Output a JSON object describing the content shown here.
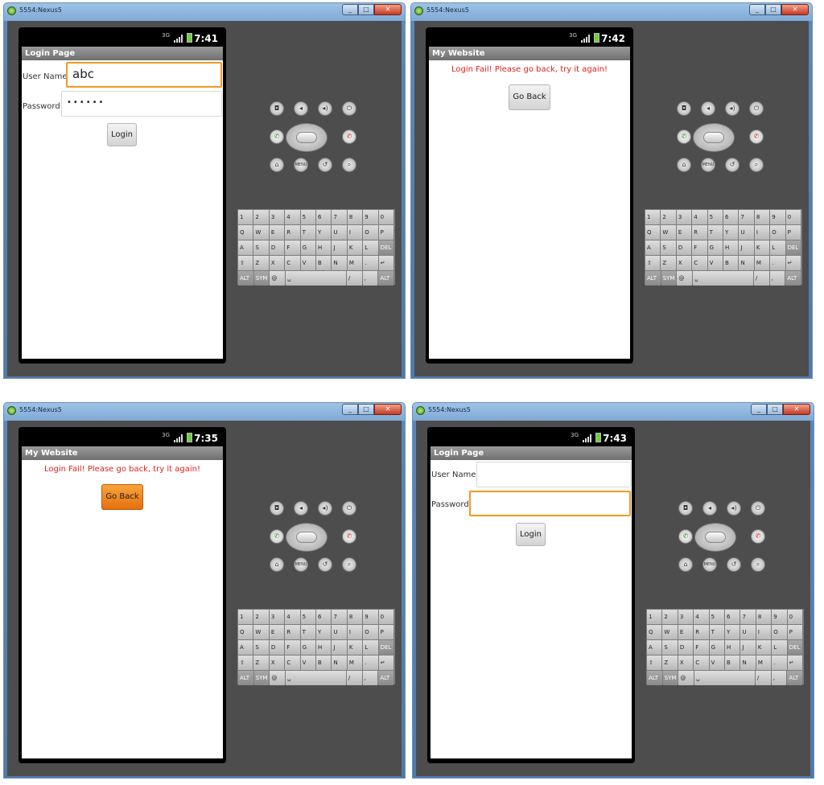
{
  "windows": [
    {
      "title": "5554:Nexus5",
      "time": "7:41",
      "network": "3G",
      "app_title": "Login Page",
      "screen": "login",
      "username_label": "User Name",
      "username_value": "abc",
      "password_label": "Password",
      "password_value": "••••••",
      "login_label": "Login",
      "focused": "username"
    },
    {
      "title": "5554:Nexus5",
      "time": "7:42",
      "network": "3G",
      "app_title": "My Website",
      "screen": "fail",
      "message": "Login Fail! Please go back, try it again!",
      "go_back_label": "Go Back",
      "pressed": false
    },
    {
      "title": "5554:Nexus5",
      "time": "7:35",
      "network": "3G",
      "app_title": "My Website",
      "screen": "fail",
      "message": "Login Fail! Please go back, try it again!",
      "go_back_label": "Go Back",
      "pressed": true
    },
    {
      "title": "5554:Nexus5",
      "time": "7:43",
      "network": "3G",
      "app_title": "Login Page",
      "screen": "login",
      "username_label": "User Name",
      "username_value": "",
      "password_label": "Password",
      "password_value": "",
      "login_label": "Login",
      "focused": "password"
    }
  ],
  "controls": {
    "menu_label": "MENU"
  },
  "keyboard": {
    "rows": [
      [
        "1",
        "2",
        "3",
        "4",
        "5",
        "6",
        "7",
        "8",
        "9",
        "0"
      ],
      [
        "Q",
        "W",
        "E",
        "R",
        "T",
        "Y",
        "U",
        "I",
        "O",
        "P"
      ],
      [
        "A",
        "S",
        "D",
        "F",
        "G",
        "H",
        "J",
        "K",
        "L",
        "DEL"
      ],
      [
        "⇧",
        "Z",
        "X",
        "C",
        "V",
        "B",
        "N",
        "M",
        ".",
        "↵"
      ],
      [
        "ALT",
        "SYM",
        "@",
        "␣",
        "/",
        ",",
        "ALT"
      ]
    ]
  },
  "colors": {
    "accent": "#f39a20",
    "error": "#e02020",
    "pressed_button": "#e56f0f"
  }
}
